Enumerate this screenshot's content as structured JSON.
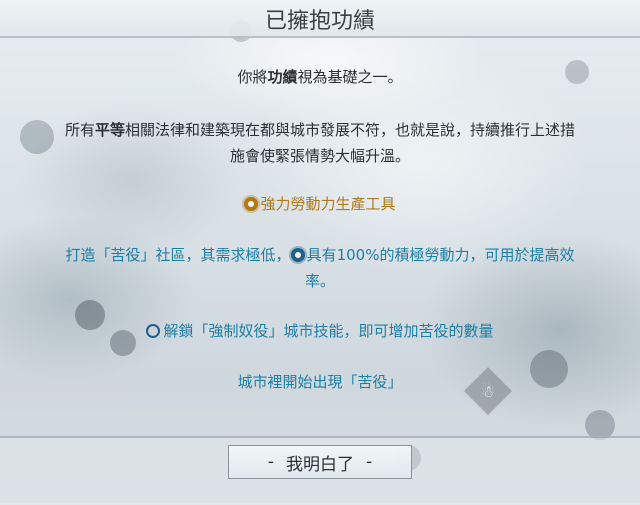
{
  "dialog": {
    "title": "已擁抱功績",
    "intro": {
      "before": "你將",
      "bold": "功績",
      "after": "視為基礎之一。"
    },
    "paragraph": {
      "line1_before": "所有",
      "line1_bold": "平等",
      "line1_after": "相關法律和建築現在都與城市發展不符，也就是說，持續推行上述措",
      "line2": "施會使緊張情勢大幅升溫。"
    },
    "effects": [
      {
        "icon": "gear-icon",
        "color": "#b07a1a",
        "text": "強力勞動力生產工具"
      },
      {
        "line1_before": "打造「苦役」社區，其需求極低，",
        "icon": "gear-icon",
        "line1_after": "具有100%的積極勞動力，可用於提高效",
        "line2": "率。",
        "color": "#1f7ea3"
      },
      {
        "icon": "chain-icon",
        "text": "解鎖「強制奴役」城市技能，即可增加苦役的數量",
        "color": "#1f7ea3"
      },
      {
        "text": "城市裡開始出現「苦役」",
        "color": "#1f7ea3"
      }
    ],
    "confirm_button": {
      "dash_left": "-",
      "label": "我明白了",
      "dash_right": "-"
    }
  }
}
